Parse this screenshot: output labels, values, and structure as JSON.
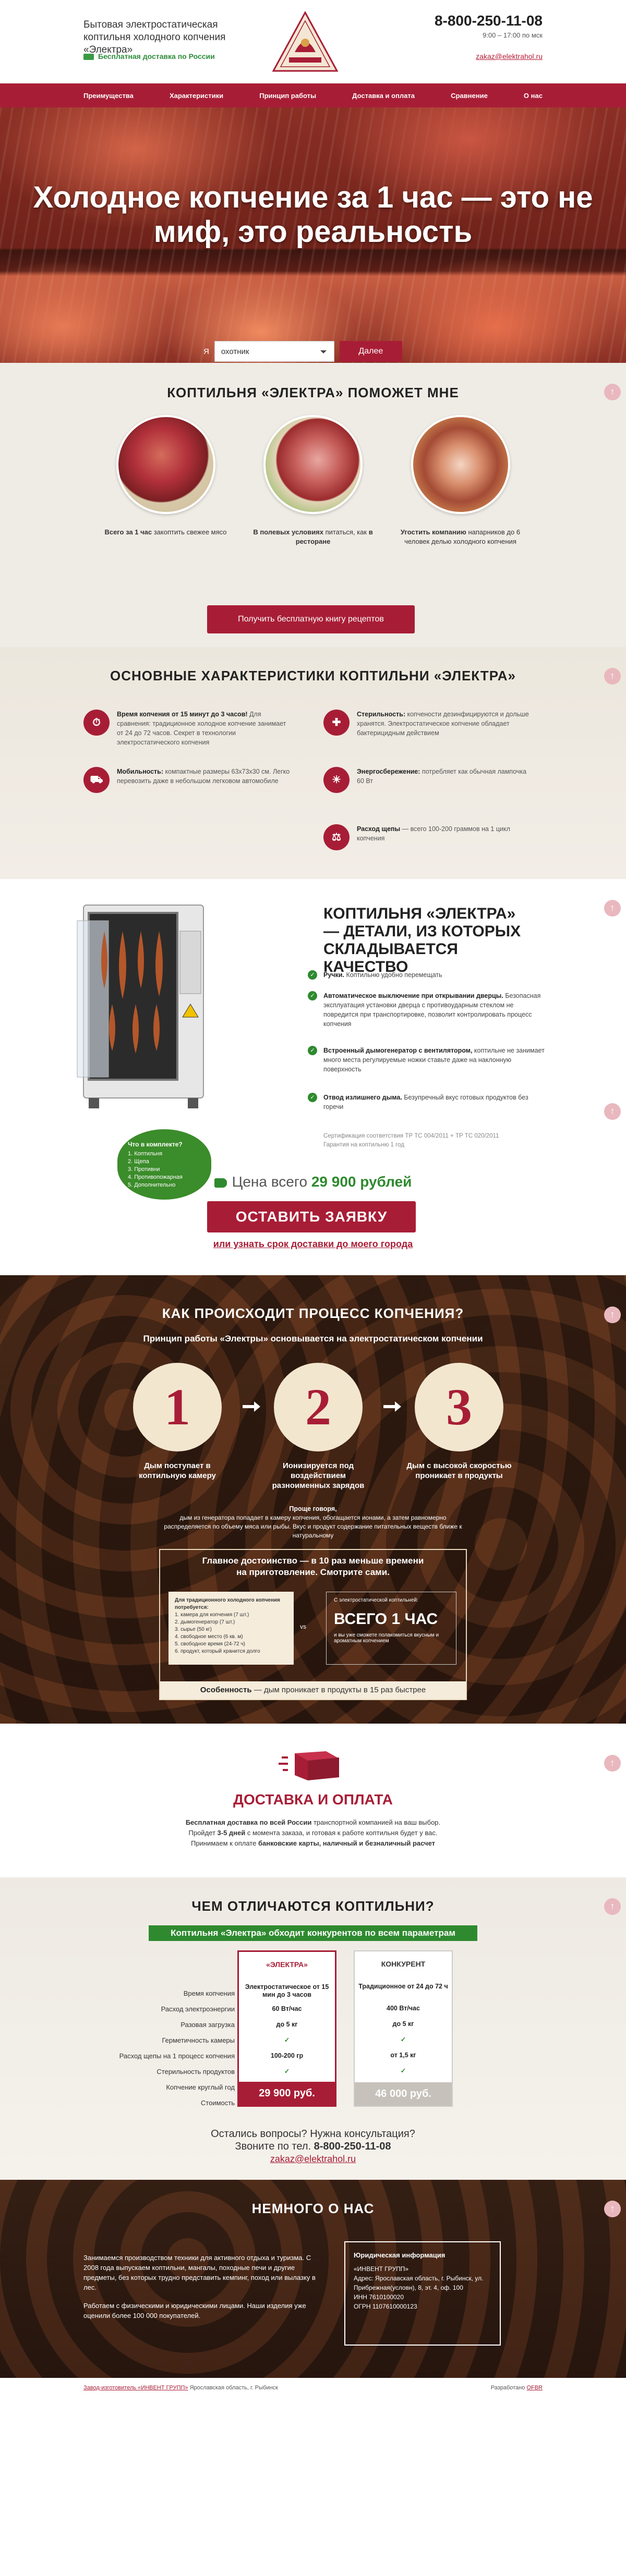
{
  "header": {
    "title": "Бытовая электростатическая коптильня холодного копчения «Электра»",
    "shipping": "Бесплатная доставка по России",
    "phone": "8-800-250-11-08",
    "hours": "9:00 – 17:00 по мск",
    "email": "zakaz@elektrahol.ru",
    "logo_text": "ИНВЕНТ ГРУПП"
  },
  "nav": [
    "Преимущества",
    "Характеристики",
    "Принцип работы",
    "Доставка и оплата",
    "Сравнение",
    "О нас"
  ],
  "hero": {
    "headline": "Холодное копчение за 1 час — это не миф, это реальность",
    "form_label": "Я",
    "select_value": "охотник",
    "submit": "Далее"
  },
  "help": {
    "title": "КОПТИЛЬНЯ «ЭЛЕКТРА» ПОМОЖЕТ МНЕ",
    "items": [
      {
        "bold": "Всего за 1 час",
        "text": "закоптить свежее мясо"
      },
      {
        "bold": "В полевых условиях",
        "text": "питаться, как",
        "bold2": "в ресторане"
      },
      {
        "bold": "Угостить компанию",
        "text": "напарников до 6 человек делью холодного копчения"
      }
    ],
    "button": "Получить бесплатную книгу рецептов"
  },
  "features": {
    "title": "ОСНОВНЫЕ ХАРАКТЕРИСТИКИ КОПТИЛЬНИ «ЭЛЕКТРА»",
    "items": [
      {
        "bold": "Время копчения от 15 минут до 3 часов!",
        "text": "Для сравнения: традиционное холодное копчение занимает от 24 до 72 часов. Секрет в технологии электростатического копчения"
      },
      {
        "bold": "Стерильность:",
        "text": "копчености дезинфицируются и дольше хранятся. Электростатическое копчение обладает бактерицидным действием"
      },
      {
        "bold": "Мобильность:",
        "text": "компактные размеры 63x73x30 см. Легко перевозить даже в небольшом легковом автомобиле"
      },
      {
        "bold": "Энергосбережение:",
        "text": "потребляет как обычная лампочка 60 Вт"
      },
      {
        "bold": "Расход щепы",
        "text": "— всего 100-200 граммов на 1 цикл копчения"
      }
    ]
  },
  "detail": {
    "title": "КОПТИЛЬНЯ «ЭЛЕКТРА» — ДЕТАЛИ, ИЗ КОТОРЫХ СКЛАДЫВАЕТСЯ КАЧЕСТВО",
    "checks": [
      {
        "bold": "Ручки.",
        "text": "Коптильню удобно перемещать"
      },
      {
        "bold": "Автоматическое выключение при открывании дверцы.",
        "text": "Безопасная эксплуатация установки дверца с противоударным стеклом не повредится при транспортировке, позволит контролировать процесс копчения"
      },
      {
        "bold": "Встроенный дымогенератор с вентилятором,",
        "text": "коптильне не занимает много места регулируемые ножки ставьте даже на наклонную поверхность"
      },
      {
        "bold": "Отвод излишнего дыма.",
        "text": "Безупречный вкус готовых продуктов без горечи"
      }
    ],
    "cert1": "Сертификация соответствия ТР ТС 004/2011 + ТР ТС 020/2011",
    "cert2": "Гарантия на коптильню 1 год",
    "badge_title": "Что в комплекте?",
    "badge_items": [
      "1. Коптильня",
      "2. Щепа",
      "3. Противни",
      "4. Противопожарная",
      "5. Дополнительно"
    ],
    "price_label": "Цена всего",
    "price_value": "29 900 рублей",
    "order": "ОСТАВИТЬ ЗАЯВКУ",
    "delivery_link": "или узнать срок доставки до моего города"
  },
  "process": {
    "title": "КАК ПРОИСХОДИТ ПРОЦЕСС КОПЧЕНИЯ?",
    "subtitle": "Принцип работы «Электры» основывается на электростатическом копчении",
    "steps": [
      {
        "num": "1",
        "text": "Дым поступает в коптильную камеру"
      },
      {
        "num": "2",
        "text": "Ионизируется под воздействием разноименных зарядов"
      },
      {
        "num": "3",
        "text": "Дым с высокой скоростью проникает в продукты"
      }
    ],
    "text_bold": "Проще говоря,",
    "text": "дым из генератора попадает в камеру копчения, обогащается ионами, а затем равномерно распределяется по объему мяса или рыбы. Вкус и продукт содержание питательных веществ ближе к натуральному",
    "adv_head1": "Главное достоинство — в 10 раз меньше времени",
    "adv_head2": "на приготовление. Смотрите сами.",
    "adv_left_title": "Для традиционного холодного копчения потребуется:",
    "adv_left_items": [
      "1. камера для копчения (7 шт.)",
      "2. дымогенератор (7 шт.)",
      "3. сырье (50 кг)",
      "4. свободное место (6 кв. м)",
      "5. свободное время (24-72 ч)",
      "6. продукт, который хранится долго"
    ],
    "adv_vs": "vs",
    "adv_right_title": "С электростатической коптильней:",
    "adv_right_big": "ВСЕГО 1 ЧАС",
    "adv_right_text": "и вы уже сможете полакомиться вкусным и ароматным копчением",
    "foot_bold": "Особенность",
    "foot_text": "— дым проникает в продукты в 15 раз быстрее"
  },
  "delivery": {
    "title": "ДОСТАВКА И ОПЛАТА",
    "line1_bold": "Бесплатная доставка по всей России",
    "line1": "транспортной компанией на ваш выбор.",
    "line2_pre": "Пройдет",
    "line2_bold": "3-5 дней",
    "line2": "с момента заказа, и готовая к работе коптильня будет у вас.",
    "line3_pre": "Принимаем к оплате",
    "line3_bold": "банковские карты, наличный и безналичный расчет"
  },
  "compare": {
    "title": "ЧЕМ ОТЛИЧАЮТСЯ КОПТИЛЬНИ?",
    "ribbon": "Коптильня «Электра» обходит конкурентов по всем параметрам",
    "rows": [
      "Время копчения",
      "Расход электроэнергии",
      "Разовая загрузка",
      "Герметичность камеры",
      "Расход щепы на 1 процесс копчения",
      "Стерильность продуктов",
      "Копчение круглый год",
      "Стоимость"
    ],
    "electra": {
      "name": "«ЭЛЕКТРА»",
      "values": [
        "Электростатическое от 15 мин до 3 часов",
        "60 Вт/час",
        "до 5 кг",
        "✓",
        "100-200 гр",
        "✓",
        "✓"
      ],
      "price": "29 900 руб."
    },
    "rival": {
      "name": "КОНКУРЕНТ",
      "values": [
        "Традиционное от 24 до 72 ч",
        "400 Вт/час",
        "до 5 кг",
        "✓",
        "от 1,5 кг",
        "✓",
        "✓"
      ],
      "price": "46 000 руб."
    },
    "q1": "Остались вопросы? Нужна консультация?",
    "q2_pre": "Звоните по тел.",
    "q2_phone": "8-800-250-11-08",
    "q3": "zakaz@elektrahol.ru"
  },
  "about": {
    "title": "НЕМНОГО О НАС",
    "p1": "Занимаемся производством техники для активного отдыха и туризма. С 2008 года выпускаем коптильни, мангалы, походные печи и другие предметы, без которых трудно представить кемпинг, поход или вылазку в лес.",
    "p2": "Работаем с физическими и юридическими лицами. Наши изделия уже оценили более 100 000 покупателей.",
    "legal_title": "Юридическая информация",
    "legal": [
      "«ИНВЕНТ ГРУПП»",
      "Адрес: Ярославская область, г. Рыбинск, ул. Прибрежная(условн), 8, эт. 4, оф. 100",
      "ИНН 7610100020",
      "ОГРН 1107610000123"
    ]
  },
  "footer": {
    "left_link": "Завод-изготовитель «ИНВЕНТ ГРУПП»",
    "left_text": "Ярославская область, г. Рыбинск",
    "right_text": "Разработано",
    "right_link": "OFBR"
  },
  "colors": {
    "brand": "#a81d36",
    "accent_green": "#2f8a2f",
    "beige": "#efece6"
  }
}
